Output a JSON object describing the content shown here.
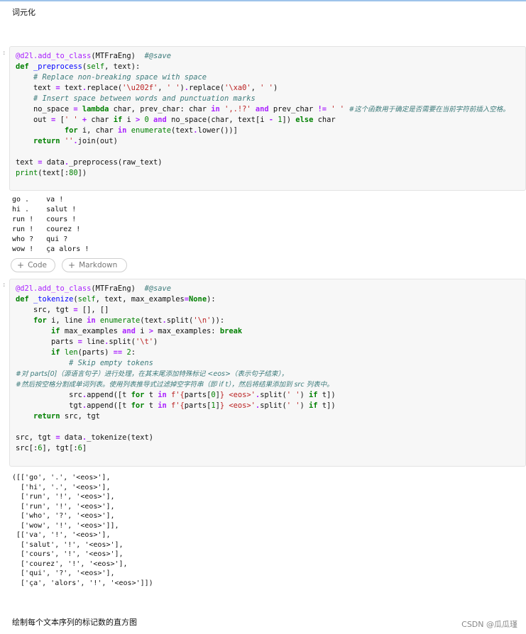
{
  "headings": {
    "lemmatize": "词元化",
    "histogram": "绘制每个文本序列的标记数的直方图"
  },
  "prompts": {
    "cell1": ":",
    "cell2": ":"
  },
  "toolbar": {
    "code_label": "Code",
    "markdown_label": "Markdown"
  },
  "cell1": {
    "lines": [
      "@d2l.add_to_class(MTFraEng)  #@save",
      "def _preprocess(self, text):",
      "    # Replace non-breaking space with space",
      "    text = text.replace('\\u202f', ' ').replace('\\xa0', ' ')",
      "    # Insert space between words and punctuation marks",
      "    no_space = lambda char, prev_char: char in ',.!?' and prev_char != ' ' #这个函数用于确定是否需要在当前字符前插入空格。",
      "    out = [' ' + char if i > 0 and no_space(char, text[i - 1]) else char",
      "           for i, char in enumerate(text.lower())]",
      "    return ''.join(out)",
      "",
      "text = data._preprocess(raw_text)",
      "print(text[:80])"
    ],
    "output": "go .    va !\nhi .    salut !\nrun !   cours !\nrun !   courez !\nwho ?   qui ?\nwow !   ça alors !"
  },
  "cell2": {
    "lines": [
      "@d2l.add_to_class(MTFraEng)  #@save",
      "def _tokenize(self, text, max_examples=None):",
      "    src, tgt = [], []",
      "    for i, line in enumerate(text.split('\\n')):",
      "        if max_examples and i > max_examples: break",
      "        parts = line.split('\\t')",
      "        if len(parts) == 2:",
      "            # Skip empty tokens",
      "#对 parts[0]（源语言句子）进行处理，在其末尾添加特殊标记 <eos>（表示句子结束），",
      "#然后按空格分割成单词列表。使用列表推导式过滤掉空字符串（即 if t），然后将结果添加到 src 列表中。",
      "            src.append([t for t in f'{parts[0]} <eos>'.split(' ') if t])",
      "            tgt.append([t for t in f'{parts[1]} <eos>'.split(' ') if t])",
      "    return src, tgt",
      "",
      "src, tgt = data._tokenize(text)",
      "src[:6], tgt[:6]"
    ],
    "output": "([['go', '.', '<eos>'],\n  ['hi', '.', '<eos>'],\n  ['run', '!', '<eos>'],\n  ['run', '!', '<eos>'],\n  ['who', '?', '<eos>'],\n  ['wow', '!', '<eos>']],\n [['va', '!', '<eos>'],\n  ['salut', '!', '<eos>'],\n  ['cours', '!', '<eos>'],\n  ['courez', '!', '<eos>'],\n  ['qui', '?', '<eos>'],\n  ['ça', 'alors', '!', '<eos>']])"
  },
  "watermark": "CSDN @瓜瓜瑾",
  "icons": {
    "add_code": "plus-icon",
    "add_markdown": "plus-icon"
  }
}
